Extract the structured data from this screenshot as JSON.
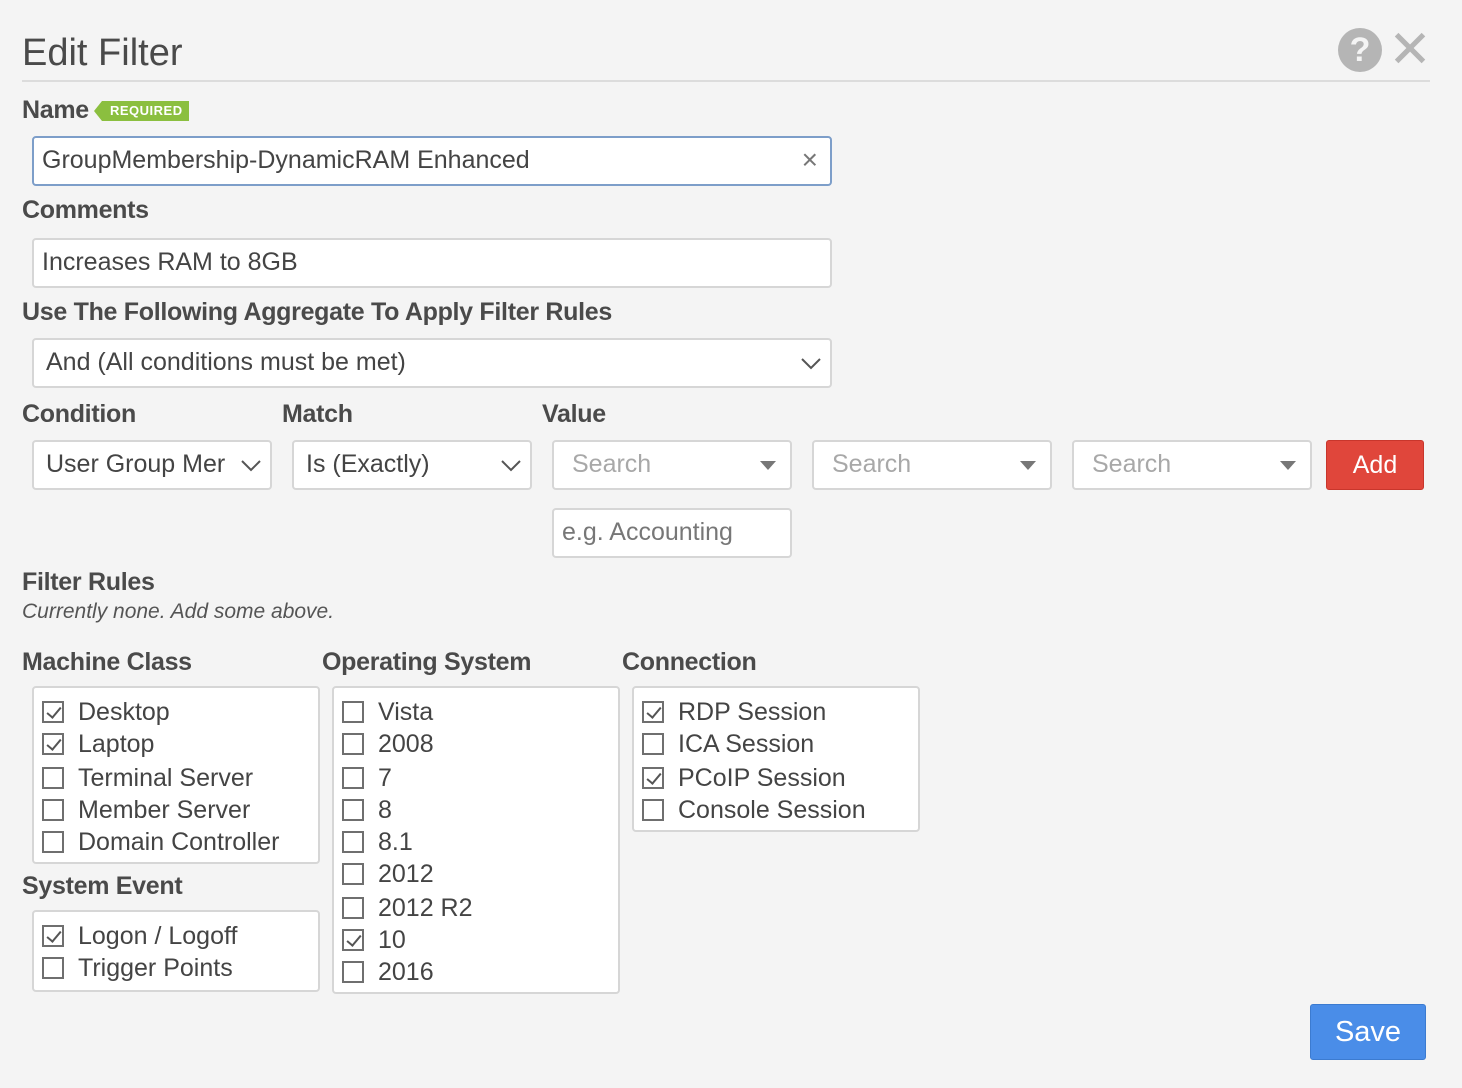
{
  "dialog": {
    "title": "Edit Filter",
    "help_icon": "question-circle-icon",
    "close_icon": "close-x-icon"
  },
  "name": {
    "label": "Name",
    "badge": "REQUIRED",
    "value": "GroupMembership-DynamicRAM Enhanced",
    "clear_glyph": "×"
  },
  "comments": {
    "label": "Comments",
    "value": "Increases RAM to 8GB"
  },
  "aggregate": {
    "label": "Use The Following Aggregate To Apply Filter Rules",
    "value": "And (All conditions must be met)"
  },
  "condition_row": {
    "condition_label": "Condition",
    "match_label": "Match",
    "value_label": "Value",
    "condition_value": "User Group Mer",
    "match_value": "Is (Exactly)",
    "search_1": "Search",
    "search_2": "Search",
    "search_3": "Search",
    "value_placeholder": "e.g. Accounting",
    "add_label": "Add"
  },
  "filter_rules": {
    "label": "Filter Rules",
    "hint": "Currently none. Add some above."
  },
  "machine_class": {
    "label": "Machine Class",
    "items": [
      {
        "label": "Desktop",
        "checked": true
      },
      {
        "label": "Laptop",
        "checked": true
      },
      {
        "label": "Terminal Server",
        "checked": false
      },
      {
        "label": "Member Server",
        "checked": false
      },
      {
        "label": "Domain Controller",
        "checked": false
      }
    ]
  },
  "system_event": {
    "label": "System Event",
    "items": [
      {
        "label": "Logon / Logoff",
        "checked": true
      },
      {
        "label": "Trigger Points",
        "checked": false
      }
    ]
  },
  "operating_system": {
    "label": "Operating System",
    "items": [
      {
        "label": "Vista",
        "checked": false
      },
      {
        "label": "2008",
        "checked": false
      },
      {
        "label": "7",
        "checked": false
      },
      {
        "label": "8",
        "checked": false
      },
      {
        "label": "8.1",
        "checked": false
      },
      {
        "label": "2012",
        "checked": false
      },
      {
        "label": "2012 R2",
        "checked": false
      },
      {
        "label": "10",
        "checked": true
      },
      {
        "label": "2016",
        "checked": false
      }
    ]
  },
  "connection": {
    "label": "Connection",
    "items": [
      {
        "label": "RDP Session",
        "checked": true
      },
      {
        "label": "ICA Session",
        "checked": false
      },
      {
        "label": "PCoIP Session",
        "checked": true
      },
      {
        "label": "Console Session",
        "checked": false
      }
    ]
  },
  "footer": {
    "save_label": "Save"
  },
  "colors": {
    "add_button": "#e0463b",
    "save_button": "#4a8de8",
    "required_badge": "#8bbf3f"
  }
}
